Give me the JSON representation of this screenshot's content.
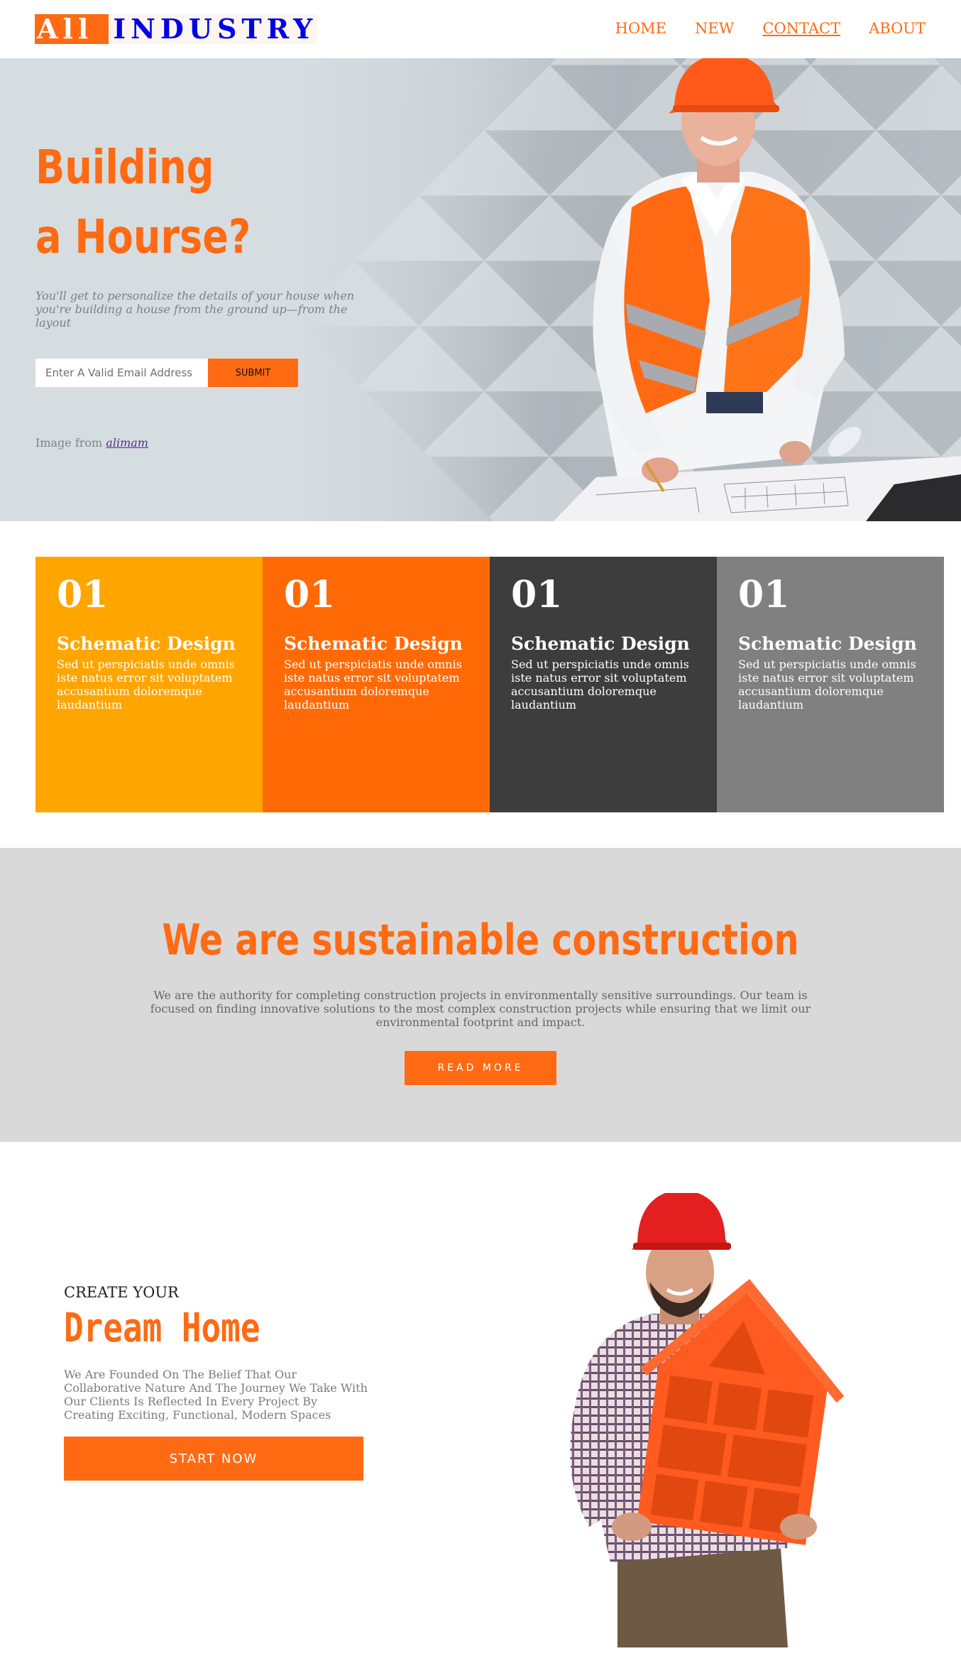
{
  "header": {
    "logo_part1": "All",
    "logo_part2": "INDUSTRY",
    "nav": [
      "HOME",
      "NEW",
      "CONTACT",
      "ABOUT"
    ]
  },
  "hero": {
    "title_line1": "Building",
    "title_line2": "a Hourse?",
    "description": "You'll get to personalize the details of your house when you're building a house from the ground up—from the layout",
    "email_placeholder": "Enter A Valid Email Address",
    "submit_label": "SUBMIT",
    "credit_prefix": "Image from",
    "credit_link": "alimam"
  },
  "features": [
    {
      "num": "01",
      "title": "Schematic Design",
      "text": "Sed ut perspiciatis unde omnis iste natus error sit voluptatem accusantium doloremque laudantium",
      "color": "#ffa500"
    },
    {
      "num": "01",
      "title": "Schematic Design",
      "text": "Sed ut perspiciatis unde omnis iste natus error sit voluptatem accusantium doloremque laudantium",
      "color": "#ff6a06"
    },
    {
      "num": "01",
      "title": "Schematic Design",
      "text": "Sed ut perspiciatis unde omnis iste natus error sit voluptatem accusantium doloremque laudantium",
      "color": "#3d3d3d"
    },
    {
      "num": "01",
      "title": "Schematic Design",
      "text": "Sed ut perspiciatis unde omnis iste natus error sit voluptatem accusantium doloremque laudantium",
      "color": "#808080"
    }
  ],
  "sustain": {
    "title": "We are sustainable construction",
    "text": "We are the authority for completing construction projects in environmentally sensitive surroundings. Our team is focused on finding innovative solutions to the most complex construction projects while ensuring that we limit our environmental footprint and impact.",
    "button": "READ MORE"
  },
  "dream": {
    "subtitle": "CREATE YOUR",
    "title": "Dream Home",
    "text": "We Are Founded On The Belief That Our Collaborative Nature And The Journey We Take With Our Clients Is Reflected In Every Project By Creating Exciting, Functional, Modern Spaces",
    "button": "START NOW"
  },
  "colors": {
    "accent": "#ff6a13",
    "logo_blue": "#0000e6"
  }
}
